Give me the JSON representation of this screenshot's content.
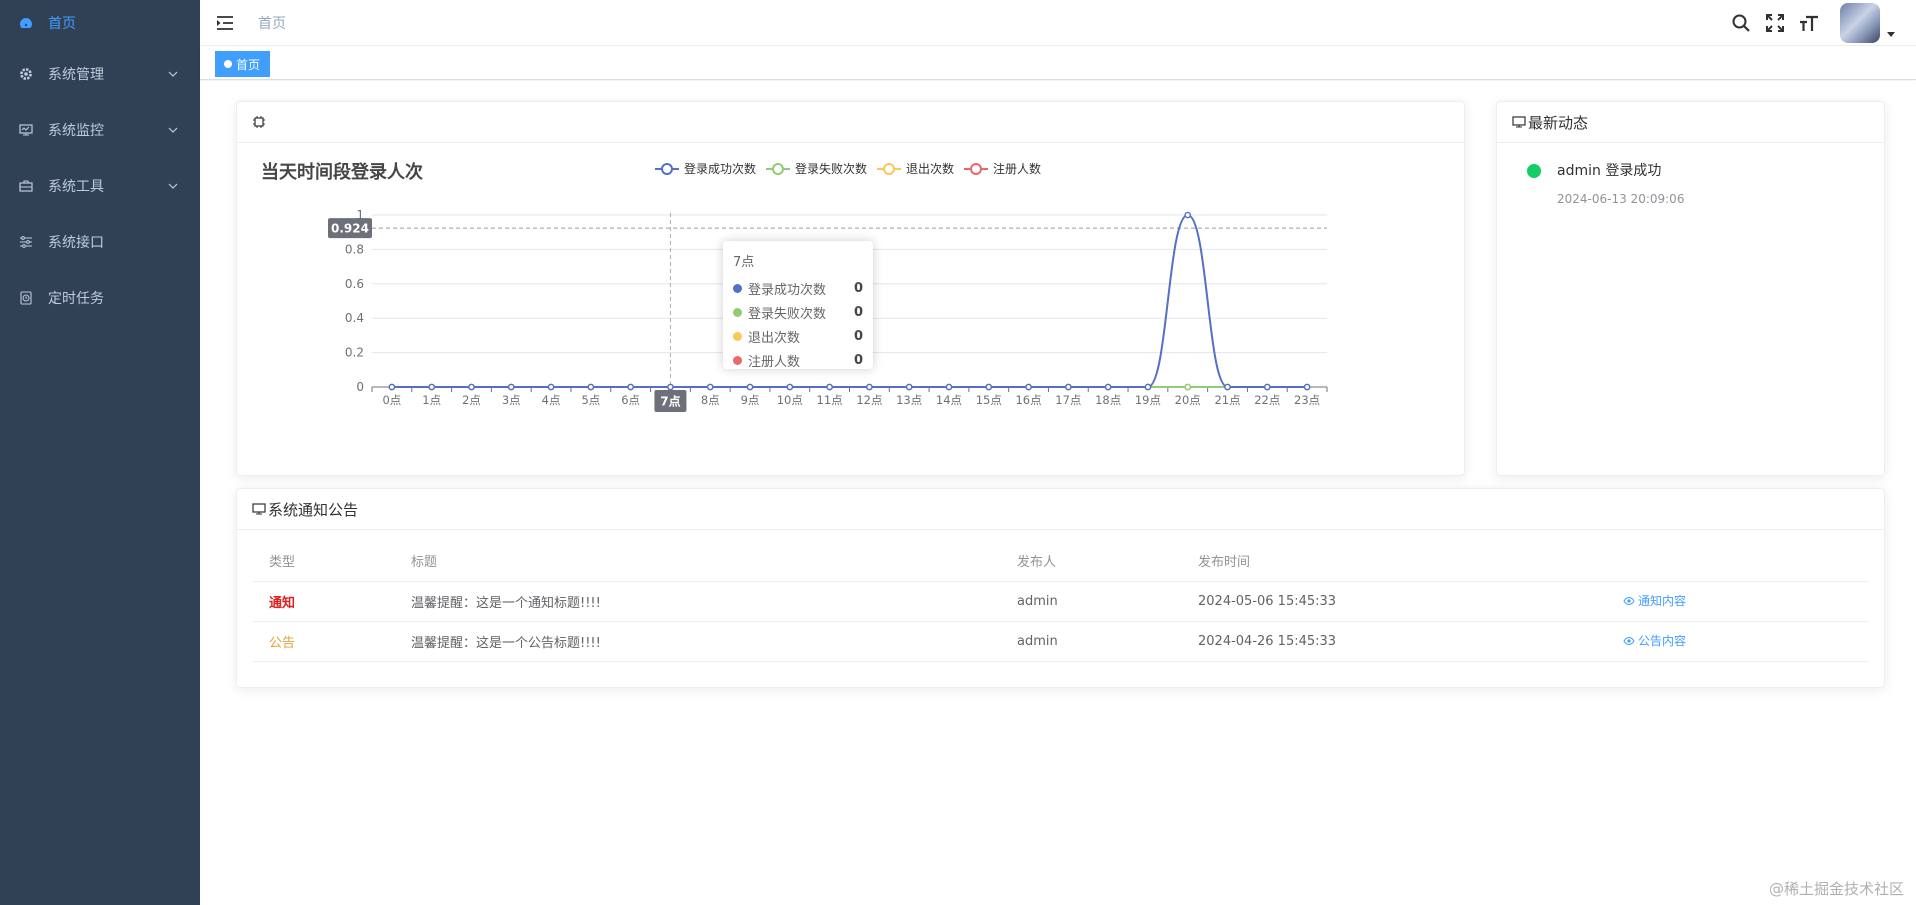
{
  "sidebar": {
    "items": [
      {
        "label": "首页",
        "icon": "dashboard-icon",
        "active": true
      },
      {
        "label": "系统管理",
        "icon": "gear-icon",
        "expandable": true
      },
      {
        "label": "系统监控",
        "icon": "monitor-icon",
        "expandable": true
      },
      {
        "label": "系统工具",
        "icon": "toolbox-icon",
        "expandable": true
      },
      {
        "label": "系统接口",
        "icon": "sliders-icon",
        "expandable": false
      },
      {
        "label": "定时任务",
        "icon": "clock-icon",
        "expandable": false
      }
    ]
  },
  "header": {
    "breadcrumb": "首页",
    "icons": [
      "search-icon",
      "fullscreen-icon",
      "font-size-icon",
      "avatar"
    ]
  },
  "tags": {
    "active_tag": "首页"
  },
  "chart_card": {
    "title": "当天时间段登录人次",
    "axis_pointer_label": "0.924",
    "x_pointer_label": "7点",
    "tooltip": {
      "title": "7点",
      "rows": [
        {
          "name": "登录成功次数",
          "value": "0",
          "color": "#5470c6"
        },
        {
          "name": "登录失败次数",
          "value": "0",
          "color": "#91cc75"
        },
        {
          "name": "退出次数",
          "value": "0",
          "color": "#fac858"
        },
        {
          "name": "注册人数",
          "value": "0",
          "color": "#ee6666"
        }
      ]
    }
  },
  "chart_data": {
    "type": "line",
    "title": "当天时间段登录人次",
    "categories": [
      "0点",
      "1点",
      "2点",
      "3点",
      "4点",
      "5点",
      "6点",
      "7点",
      "8点",
      "9点",
      "10点",
      "11点",
      "12点",
      "13点",
      "14点",
      "15点",
      "16点",
      "17点",
      "18点",
      "19点",
      "20点",
      "21点",
      "22点",
      "23点"
    ],
    "series": [
      {
        "name": "登录成功次数",
        "color": "#5470c6",
        "values": [
          0,
          0,
          0,
          0,
          0,
          0,
          0,
          0,
          0,
          0,
          0,
          0,
          0,
          0,
          0,
          0,
          0,
          0,
          0,
          0,
          1,
          0,
          0,
          0
        ]
      },
      {
        "name": "登录失败次数",
        "color": "#91cc75",
        "values": [
          0,
          0,
          0,
          0,
          0,
          0,
          0,
          0,
          0,
          0,
          0,
          0,
          0,
          0,
          0,
          0,
          0,
          0,
          0,
          0,
          0,
          0,
          0,
          0
        ]
      },
      {
        "name": "退出次数",
        "color": "#fac858",
        "values": [
          0,
          0,
          0,
          0,
          0,
          0,
          0,
          0,
          0,
          0,
          0,
          0,
          0,
          0,
          0,
          0,
          0,
          0,
          0,
          0,
          0,
          0,
          0,
          0
        ]
      },
      {
        "name": "注册人数",
        "color": "#ee6666",
        "values": [
          0,
          0,
          0,
          0,
          0,
          0,
          0,
          0,
          0,
          0,
          0,
          0,
          0,
          0,
          0,
          0,
          0,
          0,
          0,
          0,
          0,
          0,
          0,
          0
        ]
      }
    ],
    "yticks": [
      "0",
      "0.2",
      "0.4",
      "0.6",
      "0.8",
      "1"
    ],
    "ylim": [
      0,
      1
    ],
    "grid": true,
    "legend": "top-center"
  },
  "news_card": {
    "title": "最新动态",
    "items": [
      {
        "title": "admin 登录成功",
        "time": "2024-06-13 20:09:06"
      }
    ]
  },
  "notice_card": {
    "title": "系统通知公告",
    "columns": [
      "类型",
      "标题",
      "发布人",
      "发布时间",
      ""
    ],
    "rows": [
      {
        "type": "通知",
        "title": "温馨提醒：这是一个通知标题!!!!",
        "author": "admin",
        "time": "2024-05-06 15:45:33",
        "action": "通知内容"
      },
      {
        "type": "公告",
        "title": "温馨提醒：这是一个公告标题!!!!",
        "author": "admin",
        "time": "2024-04-26 15:45:33",
        "action": "公告内容"
      }
    ]
  },
  "watermark": "@稀土掘金技术社区"
}
